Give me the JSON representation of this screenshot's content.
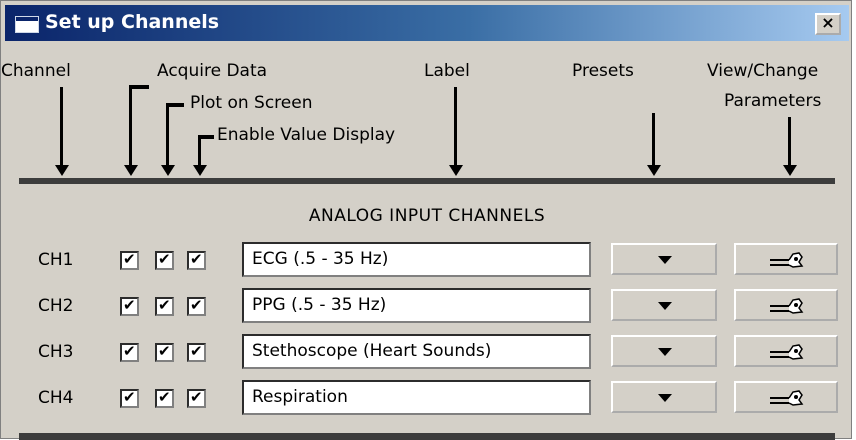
{
  "window": {
    "title": "Set up Channels",
    "close_glyph": "×"
  },
  "headers": {
    "channel": "Channel",
    "acquire": "Acquire Data",
    "plot": "Plot on Screen",
    "enable": "Enable Value Display",
    "label": "Label",
    "presets": "Presets",
    "view_change_line1": "View/Change",
    "view_change_line2": "Parameters"
  },
  "section_title": "ANALOG  INPUT  CHANNELS",
  "channels": [
    {
      "name": "CH1",
      "label": "ECG (.5 - 35 Hz)",
      "acquire": true,
      "plot": true,
      "enable": true
    },
    {
      "name": "CH2",
      "label": "PPG (.5 - 35 Hz)",
      "acquire": true,
      "plot": true,
      "enable": true
    },
    {
      "name": "CH3",
      "label": "Stethoscope (Heart Sounds)",
      "acquire": true,
      "plot": true,
      "enable": true
    },
    {
      "name": "CH4",
      "label": "Respiration",
      "acquire": true,
      "plot": true,
      "enable": true
    }
  ],
  "icons": {
    "window": "window-icon",
    "close": "close-icon",
    "preset_dropdown": "dropdown-arrow-icon",
    "parameters": "wrench-hand-icon"
  },
  "colors": {
    "title_bar_start": "#0a246a",
    "title_bar_end": "#a6caf0",
    "window_bg": "#d4d0c8",
    "divider": "#3c3c3c"
  }
}
